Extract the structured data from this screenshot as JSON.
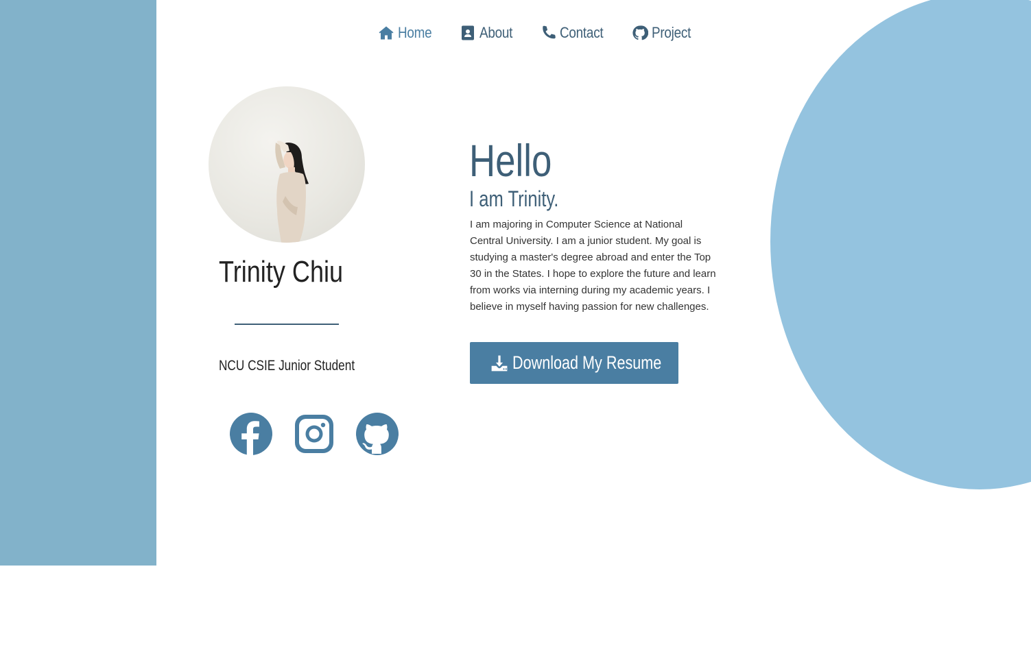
{
  "nav": {
    "items": [
      {
        "label": "Home",
        "icon": "home-icon",
        "active": true
      },
      {
        "label": "About",
        "icon": "contact-card-icon",
        "active": false
      },
      {
        "label": "Contact",
        "icon": "phone-icon",
        "active": false
      },
      {
        "label": "Project",
        "icon": "github-icon",
        "active": false
      }
    ]
  },
  "profile": {
    "name": "Trinity Chiu",
    "subtitle": "NCU CSIE Junior Student",
    "avatar_icon": "profile-photo",
    "socials": [
      {
        "icon": "facebook-icon"
      },
      {
        "icon": "instagram-icon"
      },
      {
        "icon": "github-icon"
      }
    ]
  },
  "hero": {
    "greeting": "Hello",
    "intro": "I am Trinity.",
    "bio": "I am majoring in Computer Science at National Central University. I am a junior student. My goal is studying a master's degree abroad and enter the Top 30 in the States. I hope to explore the future and learn from works via interning during my academic years. I believe in myself having passion for new challenges.",
    "resume_button": "Download My Resume",
    "resume_icon": "download-icon"
  },
  "colors": {
    "accent": "#4a7ea2",
    "text_dark_blue": "#3e5f77",
    "left_strip": "#82b2ca",
    "blob": "#94c3df"
  }
}
